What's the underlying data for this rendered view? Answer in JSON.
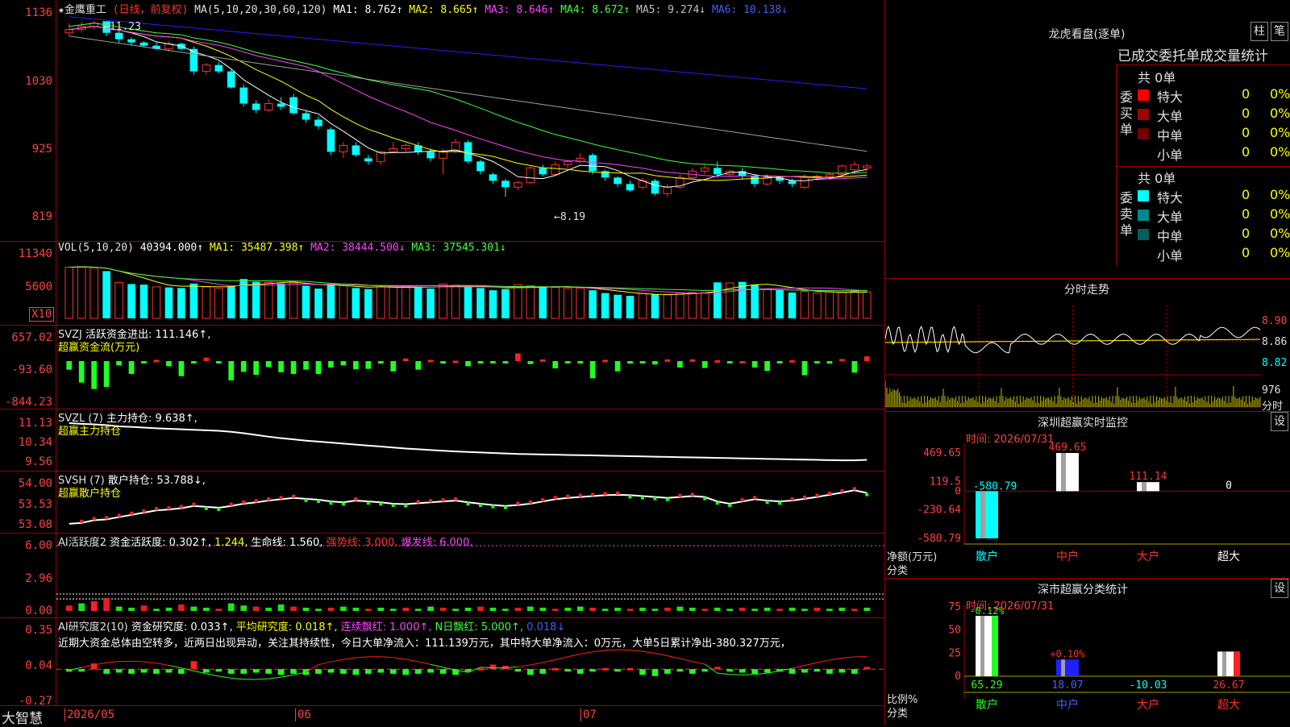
{
  "main_header": {
    "stock_name": "★金鹰重工",
    "mode": "(日线，前复权)",
    "ma_label": "MA(5,10,20,30,60,120)",
    "ma1": "MA1: 8.762↑",
    "ma2": "MA2: 8.665↑",
    "ma3": "MA3: 8.646↑",
    "ma4": "MA4: 8.672↑",
    "ma5": "MA5: 9.274↓",
    "ma6": "MA6: 10.138↓"
  },
  "vol_header": {
    "name": "VOL(5,10,20)",
    "value": "40394.000↑",
    "ma1": "MA1: 35487.398↑",
    "ma2": "MA2: 38444.500↓",
    "ma3": "MA3: 37545.301↓",
    "unit": "X10"
  },
  "svzj_header": {
    "name": "SVZJ",
    "value": "活跃资金进出: 111.146↑,",
    "sub": "超赢资金流(万元)"
  },
  "svzl_header": {
    "name": "SVZL (7)",
    "value": "主力持仓: 9.638↑,",
    "sub": "超赢主力持仓"
  },
  "svsh_header": {
    "name": "SVSH (7)",
    "value": "散户持仓: 53.788↓,",
    "sub": "超赢散户持仓"
  },
  "ai1_header": {
    "name": "AI活跃度2",
    "v1": "资金活跃度: 0.302↑,",
    "v2": "1.244,",
    "v3": "生命线: 1.560,",
    "v4": "强势线: 3.000,",
    "v5": "爆发线: 6.000,"
  },
  "ai2_header": {
    "name": "AI研究度2(10)",
    "v1": "资金研究度: 0.033↑,",
    "v2": "平均研究度: 0.018↑,",
    "v3": "连续飘红: 1.000↑,",
    "v4": "N日飘红: 5.000↑,",
    "v5": "0.018↓",
    "comment": "近期大资金总体由空转多，近两日出现异动，关注其持续性，今日大单净流入：111.139万元，其中特大单净流入：0万元，大单5日累计净出-380.327万元，"
  },
  "brand": "大智慧",
  "dates": [
    "2026/05",
    "06",
    "07"
  ],
  "price_ticks": [
    "1136",
    "1030",
    "925",
    "819"
  ],
  "price_annot": {
    "high": "11.23",
    "low": "8.19"
  },
  "vol_ticks": [
    "11340",
    "5600"
  ],
  "svzj_ticks": [
    "657.02",
    "-93.60",
    "-844.23"
  ],
  "svzl_ticks": [
    "11.13",
    "10.34",
    "9.56"
  ],
  "svsh_ticks": [
    "54.00",
    "53.53",
    "53.08"
  ],
  "ai1_ticks": [
    "6.00",
    "2.96",
    "0.00"
  ],
  "ai2_ticks": [
    "0.35",
    "0.04",
    "-0.27"
  ],
  "right": {
    "lhb_title": "龙虎看盘(逐单)",
    "btn1": "柱",
    "btn2": "笔",
    "lhb_sub": "已成交委托单成交量统计",
    "buy_side": "委买单",
    "sell_side": "委卖单",
    "buy_total": "共 0单",
    "sell_total": "共 0单",
    "buy_rows": [
      {
        "name": "特大",
        "count": "0",
        "pct": "0%"
      },
      {
        "name": "大单",
        "count": "0",
        "pct": "0%"
      },
      {
        "name": "中单",
        "count": "0",
        "pct": "0%"
      },
      {
        "name": "小单",
        "count": "0",
        "pct": "0%"
      }
    ],
    "sell_rows": [
      {
        "name": "特大",
        "count": "0",
        "pct": "0%"
      },
      {
        "name": "大单",
        "count": "0",
        "pct": "0%"
      },
      {
        "name": "中单",
        "count": "0",
        "pct": "0%"
      },
      {
        "name": "小单",
        "count": "0",
        "pct": "0%"
      }
    ],
    "intraday_title": "分时走势",
    "intraday_ticks": [
      "8.90",
      "8.86",
      "8.82"
    ],
    "intraday_vol": "976",
    "intraday_label": "分时",
    "sz_title": "深圳超赢实时监控",
    "sz_btn": "设",
    "sz_time": "时间: 2026/07/31",
    "sz_ticks": [
      "469.65",
      "119.5",
      "0",
      "-230.64",
      "-580.79"
    ],
    "sz_axis_label1": "净额(万元)",
    "sz_axis_label2": "分类",
    "sz_categories": [
      "散户",
      "中户",
      "大户",
      "超大"
    ],
    "sz_values": [
      -580.79,
      469.65,
      111.14,
      0
    ],
    "sz_value_labels": [
      "-580.79",
      "469.65",
      "111.14",
      "0"
    ],
    "cls_title": "深市超赢分类统计",
    "cls_btn": "设",
    "cls_time": "时间: 2026/07/31",
    "cls_ticks": [
      "75",
      "50",
      "25",
      "0"
    ],
    "cls_axis_label1": "比例%",
    "cls_axis_label2": "分类",
    "cls_categories": [
      "散户",
      "中户",
      "大户",
      "超大"
    ],
    "cls_values": [
      65.29,
      18.07,
      -10.03,
      26.67
    ],
    "cls_value_labels": [
      "65.29",
      "18.07",
      "-10.03",
      "26.67"
    ],
    "cls_top_labels": [
      "-0.12%",
      "+0.10%"
    ]
  },
  "chart_data": [
    {
      "type": "candlestick",
      "ylim": [
        8.19,
        11.36
      ],
      "candles": [
        [
          11.05,
          11.1,
          11.2,
          11.0
        ],
        [
          11.1,
          11.15,
          11.22,
          11.05
        ],
        [
          11.15,
          11.2,
          11.23,
          11.1
        ],
        [
          11.23,
          11.05,
          11.23,
          11.0
        ],
        [
          11.05,
          10.95,
          11.08,
          10.9
        ],
        [
          10.95,
          10.9,
          10.98,
          10.85
        ],
        [
          10.9,
          10.85,
          10.92,
          10.82
        ],
        [
          10.85,
          10.8,
          10.9,
          10.78
        ],
        [
          10.8,
          10.88,
          10.92,
          10.76
        ],
        [
          10.88,
          10.8,
          10.9,
          10.78
        ],
        [
          10.8,
          10.45,
          10.84,
          10.4
        ],
        [
          10.45,
          10.55,
          10.58,
          10.4
        ],
        [
          10.55,
          10.45,
          10.6,
          10.42
        ],
        [
          10.45,
          10.2,
          10.48,
          10.18
        ],
        [
          10.2,
          9.95,
          10.25,
          9.9
        ],
        [
          9.95,
          9.85,
          10.0,
          9.8
        ],
        [
          9.85,
          9.95,
          10.02,
          9.82
        ],
        [
          9.95,
          9.9,
          10.05,
          9.85
        ],
        [
          10.05,
          9.8,
          10.1,
          9.78
        ],
        [
          9.8,
          9.7,
          9.85,
          9.65
        ],
        [
          9.7,
          9.6,
          9.75,
          9.55
        ],
        [
          9.55,
          9.2,
          9.58,
          9.15
        ],
        [
          9.2,
          9.3,
          9.35,
          9.1
        ],
        [
          9.3,
          9.15,
          9.35,
          9.12
        ],
        [
          9.1,
          9.05,
          9.15,
          9.0
        ],
        [
          9.05,
          9.2,
          9.22,
          9.0
        ],
        [
          9.2,
          9.25,
          9.35,
          9.18
        ],
        [
          9.25,
          9.3,
          9.33,
          9.2
        ],
        [
          9.3,
          9.2,
          9.35,
          9.15
        ],
        [
          9.2,
          9.1,
          9.25,
          9.05
        ],
        [
          9.1,
          9.2,
          9.25,
          8.85
        ],
        [
          9.2,
          9.35,
          9.4,
          9.18
        ],
        [
          9.35,
          9.05,
          9.38,
          9.02
        ],
        [
          9.05,
          8.9,
          9.08,
          8.85
        ],
        [
          8.85,
          8.75,
          8.88,
          8.7
        ],
        [
          8.75,
          8.65,
          8.78,
          8.5
        ],
        [
          8.65,
          8.72,
          8.75,
          8.6
        ],
        [
          8.72,
          8.95,
          8.98,
          8.7
        ],
        [
          8.95,
          8.85,
          9.0,
          8.82
        ],
        [
          8.85,
          9.0,
          9.05,
          8.82
        ],
        [
          9.0,
          9.05,
          9.08,
          8.95
        ],
        [
          9.05,
          9.1,
          9.18,
          9.02
        ],
        [
          9.15,
          8.9,
          9.18,
          8.85
        ],
        [
          8.9,
          8.8,
          8.92,
          8.75
        ],
        [
          8.8,
          8.7,
          8.82,
          8.65
        ],
        [
          8.7,
          8.6,
          8.75,
          8.58
        ],
        [
          8.65,
          8.75,
          8.8,
          8.62
        ],
        [
          8.75,
          8.55,
          8.78,
          8.52
        ],
        [
          8.55,
          8.65,
          8.7,
          8.5
        ],
        [
          8.65,
          8.8,
          8.85,
          8.62
        ],
        [
          8.8,
          8.9,
          8.95,
          8.78
        ],
        [
          8.9,
          8.95,
          9.0,
          8.85
        ],
        [
          8.95,
          8.85,
          9.05,
          8.8
        ],
        [
          8.85,
          8.9,
          8.92,
          8.8
        ],
        [
          8.9,
          8.82,
          8.95,
          8.78
        ],
        [
          8.82,
          8.7,
          8.85,
          8.65
        ],
        [
          8.7,
          8.8,
          8.85,
          8.68
        ],
        [
          8.8,
          8.75,
          8.82,
          8.7
        ],
        [
          8.75,
          8.7,
          8.78,
          8.65
        ],
        [
          8.65,
          8.8,
          8.85,
          8.62
        ],
        [
          8.8,
          8.82,
          8.85,
          8.75
        ],
        [
          8.82,
          8.85,
          8.88,
          8.78
        ],
        [
          8.85,
          8.98,
          9.0,
          8.82
        ],
        [
          8.92,
          9.0,
          9.05,
          8.85
        ],
        [
          8.95,
          8.98,
          9.02,
          8.9
        ]
      ]
    },
    {
      "type": "bar",
      "name": "VOL",
      "ylim": [
        0,
        11340
      ],
      "values": [
        9100,
        9200,
        9000,
        8400,
        6400,
        6100,
        6000,
        5600,
        5500,
        5400,
        6200,
        5600,
        5300,
        5700,
        7000,
        6500,
        6400,
        6200,
        6300,
        5800,
        5300,
        6100,
        5800,
        5400,
        5200,
        5600,
        5700,
        5600,
        5500,
        5300,
        6100,
        5900,
        5700,
        5400,
        5000,
        5200,
        6000,
        5800,
        5600,
        5500,
        5300,
        5400,
        5000,
        4500,
        4200,
        4000,
        4400,
        4300,
        4200,
        4500,
        4600,
        4700,
        6400,
        6300,
        6500,
        6000,
        5200,
        5000,
        4600,
        4800,
        4500,
        4700,
        4600,
        4800,
        4700
      ],
      "up": [
        1,
        1,
        1,
        0,
        1,
        0,
        0,
        1,
        0,
        0,
        0,
        1,
        1,
        0,
        0,
        0,
        1,
        0,
        1,
        0,
        0,
        0,
        1,
        0,
        0,
        1,
        1,
        1,
        0,
        0,
        1,
        1,
        0,
        0,
        0,
        0,
        1,
        1,
        0,
        1,
        1,
        1,
        0,
        0,
        0,
        0,
        1,
        0,
        1,
        1,
        1,
        1,
        0,
        1,
        0,
        0,
        1,
        0,
        0,
        1,
        1,
        1,
        1,
        1,
        1
      ]
    },
    {
      "type": "bar",
      "name": "SVZJ",
      "ylim": [
        -844.23,
        657.02
      ],
      "values": [
        -200,
        -500,
        -650,
        -600,
        -100,
        -300,
        -50,
        30,
        -120,
        -350,
        -50,
        80,
        -50,
        -450,
        -250,
        -320,
        -140,
        -260,
        -300,
        -200,
        -300,
        -150,
        -100,
        -190,
        -180,
        -60,
        -240,
        60,
        -200,
        30,
        -60,
        10,
        -120,
        -50,
        -40,
        -50,
        180,
        -70,
        40,
        -170,
        -30,
        -20,
        -400,
        30,
        -240,
        -60,
        -20,
        -80,
        40,
        -150,
        40,
        -160,
        20,
        -20,
        0,
        -150,
        -230,
        -40,
        20,
        -330,
        -40,
        -60,
        50,
        -270,
        111
      ],
      "ylabel": "超赢资金流(万元)"
    },
    {
      "type": "line",
      "name": "SVZL",
      "ylim": [
        9.56,
        11.13
      ],
      "values": [
        11.13,
        11.1,
        11.08,
        11.05,
        11.0,
        10.98,
        10.95,
        10.92,
        10.9,
        10.88,
        10.86,
        10.84,
        10.82,
        10.78,
        10.72,
        10.65,
        10.58,
        10.52,
        10.47,
        10.42,
        10.38,
        10.34,
        10.3,
        10.26,
        10.22,
        10.18,
        10.14,
        10.1,
        10.07,
        10.04,
        10.01,
        9.98,
        9.96,
        9.94,
        9.92,
        9.9,
        9.88,
        9.87,
        9.86,
        9.85,
        9.84,
        9.83,
        9.82,
        9.81,
        9.8,
        9.79,
        9.78,
        9.77,
        9.76,
        9.75,
        9.74,
        9.73,
        9.72,
        9.71,
        9.7,
        9.69,
        9.68,
        9.67,
        9.66,
        9.65,
        9.64,
        9.63,
        9.62,
        9.62,
        9.64
      ]
    },
    {
      "type": "line",
      "name": "SVSH",
      "ylim": [
        53.08,
        54.0
      ],
      "values": [
        53.1,
        53.12,
        53.18,
        53.2,
        53.25,
        53.3,
        53.35,
        53.4,
        53.42,
        53.45,
        53.5,
        53.48,
        53.46,
        53.5,
        53.55,
        53.58,
        53.62,
        53.65,
        53.68,
        53.66,
        53.64,
        53.6,
        53.58,
        53.62,
        53.6,
        53.58,
        53.55,
        53.54,
        53.56,
        53.58,
        53.6,
        53.62,
        53.58,
        53.55,
        53.52,
        53.5,
        53.52,
        53.55,
        53.6,
        53.65,
        53.68,
        53.7,
        53.72,
        53.74,
        53.75,
        53.74,
        53.72,
        53.7,
        53.68,
        53.7,
        53.72,
        53.7,
        53.6,
        53.55,
        53.6,
        53.65,
        53.62,
        53.6,
        53.62,
        53.66,
        53.7,
        53.75,
        53.8,
        53.85,
        53.79
      ]
    },
    {
      "type": "bar",
      "name": "AI活跃度2",
      "ylim": [
        0,
        6.0
      ],
      "values": [
        0.5,
        0.7,
        0.9,
        1.2,
        0.4,
        0.3,
        0.5,
        0.2,
        0.3,
        0.6,
        0.4,
        0.3,
        0.2,
        0.7,
        0.5,
        0.4,
        0.3,
        0.6,
        0.4,
        0.3,
        0.2,
        0.3,
        0.4,
        0.3,
        0.2,
        0.3,
        0.2,
        0.3,
        0.2,
        0.4,
        0.3,
        0.2,
        0.3,
        0.4,
        0.3,
        0.2,
        0.3,
        0.4,
        0.3,
        0.2,
        0.3,
        0.4,
        0.3,
        0.2,
        0.3,
        0.2,
        0.3,
        0.2,
        0.3,
        0.4,
        0.3,
        0.2,
        0.3,
        0.2,
        0.3,
        0.2,
        0.3,
        0.2,
        0.3,
        0.2,
        0.3,
        0.2,
        0.3,
        0.2,
        0.3
      ],
      "life_line": 1.56,
      "strong_line": 3.0,
      "burst_line": 6.0
    },
    {
      "type": "bar",
      "name": "AI研究度2(10)",
      "ylim": [
        -0.27,
        0.35
      ],
      "values": [
        0.01,
        0.0,
        0.06,
        -0.03,
        -0.02,
        -0.03,
        -0.02,
        -0.03,
        -0.02,
        -0.03,
        0.08,
        -0.02,
        0.01,
        -0.03,
        -0.03,
        -0.02,
        -0.03,
        -0.04,
        -0.03,
        -0.04,
        -0.03,
        -0.02,
        -0.03,
        -0.04,
        -0.03,
        -0.02,
        -0.03,
        -0.04,
        -0.03,
        -0.02,
        -0.03,
        -0.04,
        0.01,
        0.02,
        0.05,
        0.04,
        0.01,
        -0.04,
        -0.03,
        0.02,
        0.01,
        -0.03,
        0.01,
        0.02,
        0.01,
        0.02,
        -0.04,
        -0.05,
        -0.03,
        0.01,
        -0.03,
        0.01,
        0.03,
        0.01,
        -0.02,
        -0.03,
        -0.02,
        0.01,
        -0.03,
        -0.02,
        0.01,
        -0.03,
        -0.02,
        -0.03,
        0.03
      ]
    }
  ]
}
